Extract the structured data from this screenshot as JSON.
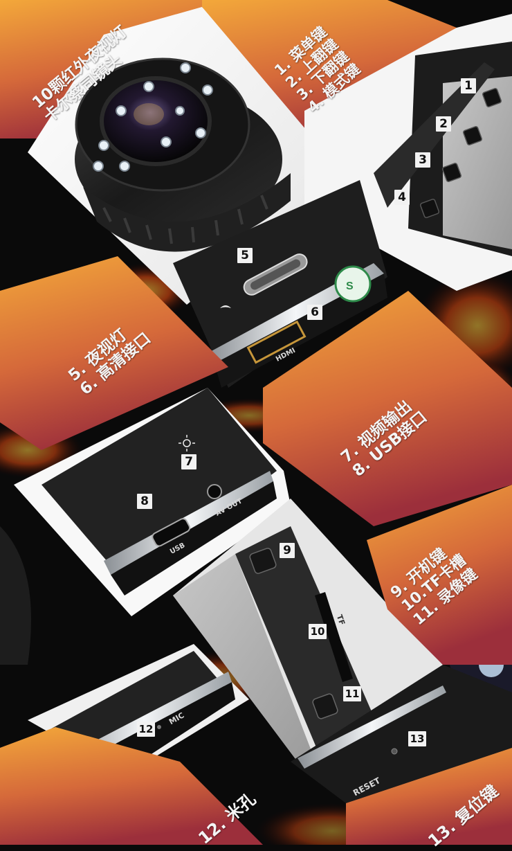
{
  "colors": {
    "banner_top": "#f0a53a",
    "banner_bottom": "#a0343a",
    "background": "#0a0a0a",
    "device_black": "#1c1c1c",
    "chrome": "#d8dde2"
  },
  "banners": {
    "lens": {
      "line1": "10颗红外夜视灯",
      "line2": "卡尔蔡司镜头"
    },
    "buttons": {
      "line1": "1. 菜单键",
      "line2": "2. 上翻键",
      "line3": "3. 下翻键",
      "line4": "4. 模式键"
    },
    "night_hdmi": {
      "line1": "5. 夜视灯",
      "line2": "6. 高清接口"
    },
    "av_usb": {
      "line1": "7. 视频输出",
      "line2": "8. USB接口"
    },
    "power_tf": {
      "line1": "9. 开机键",
      "line2": "10.TF卡槽",
      "line3": "11. 录像键"
    },
    "mic": {
      "line1": "12. 米孔"
    },
    "reset": {
      "line1": "13. 复位键"
    }
  },
  "markers": [
    "1",
    "2",
    "3",
    "4",
    "5",
    "6",
    "7",
    "8",
    "9",
    "10",
    "11",
    "12",
    "13"
  ],
  "device_labels": {
    "hdmi": "HDMI",
    "usb": "USB",
    "av_out": "AV OUT",
    "tf": "TF",
    "mic": "MIC",
    "reset": "RESET"
  }
}
